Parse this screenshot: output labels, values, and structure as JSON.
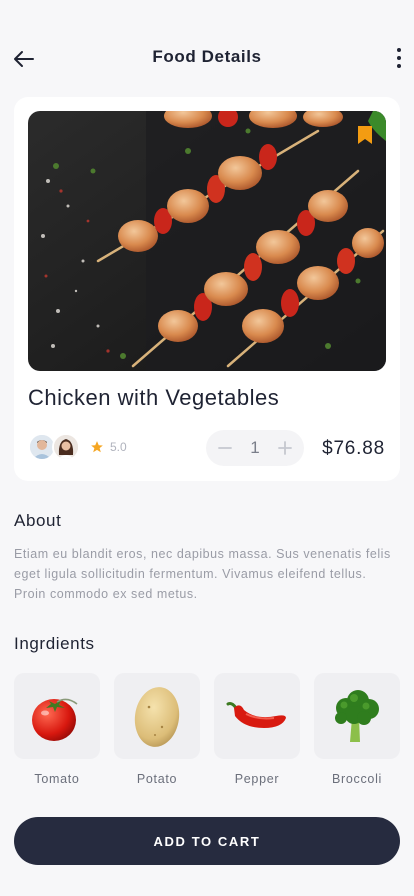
{
  "header": {
    "title": "Food Details",
    "back_icon": "arrow-left-icon",
    "more_icon": "more-vertical-icon"
  },
  "food": {
    "name": "Chicken with Vegetables",
    "rating": "5.0",
    "quantity": "1",
    "price": "$76.88",
    "bookmark_color": "#f39c12",
    "star_color": "#f5a623"
  },
  "about": {
    "title": "About",
    "text": "Etiam eu blandit eros, nec dapibus massa. Sus venenatis felis eget ligula sollicitudin fermentum. Vivamus  eleifend tellus. Proin commodo ex sed metus."
  },
  "ingredients": {
    "title": "Ingrdients",
    "items": [
      {
        "label": "Tomato",
        "icon": "tomato-icon"
      },
      {
        "label": "Potato",
        "icon": "potato-icon"
      },
      {
        "label": "Pepper",
        "icon": "pepper-icon"
      },
      {
        "label": "Broccoli",
        "icon": "broccoli-icon"
      }
    ]
  },
  "cart": {
    "label": "ADD TO CART",
    "color": "#262b3f"
  }
}
